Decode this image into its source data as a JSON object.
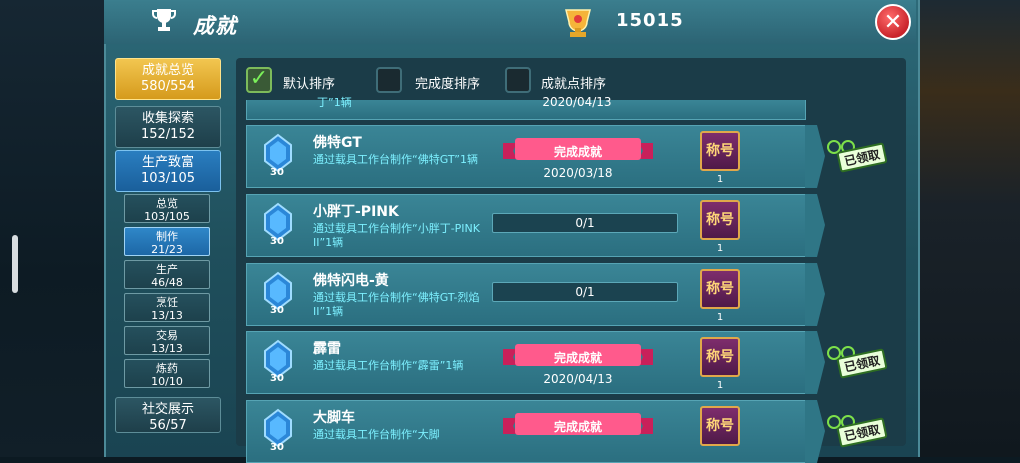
{
  "header": {
    "title": "成就",
    "points": "15015"
  },
  "sidebar": {
    "main_items": [
      {
        "label": "成就总览",
        "count": "580/554"
      },
      {
        "label": "收集探索",
        "count": "152/152"
      },
      {
        "label": "生产致富",
        "count": "103/105"
      },
      {
        "label": "社交展示",
        "count": "56/57"
      }
    ],
    "sub_items": [
      {
        "label": "总览",
        "count": "103/105"
      },
      {
        "label": "制作",
        "count": "21/23"
      },
      {
        "label": "生产",
        "count": "46/48"
      },
      {
        "label": "烹饪",
        "count": "13/13"
      },
      {
        "label": "交易",
        "count": "13/13"
      },
      {
        "label": "炼药",
        "count": "10/10"
      }
    ]
  },
  "sort": {
    "default": "默认排序",
    "completion": "完成度排序",
    "points": "成就点排序"
  },
  "partial_top": {
    "desc": "丁”1辆",
    "date": "2020/04/13"
  },
  "achievements": [
    {
      "name": "佛特GT",
      "desc": "通过载具工作台制作“佛特GT”1辆",
      "points": "30",
      "status": "完成成就",
      "date": "2020/03/18",
      "reward": "称号",
      "reward_count": "1",
      "claimed": "已领取"
    },
    {
      "name": "小胖丁-PINK",
      "desc": "通过载具工作台制作“小胖丁-PINK II”1辆",
      "points": "30",
      "progress": "0/1",
      "reward": "称号",
      "reward_count": "1"
    },
    {
      "name": "佛特闪电-黄",
      "desc": "通过载具工作台制作“佛特GT-烈焰II”1辆",
      "points": "30",
      "progress": "0/1",
      "reward": "称号",
      "reward_count": "1"
    },
    {
      "name": "霹雷",
      "desc": "通过载具工作台制作“霹雷”1辆",
      "points": "30",
      "status": "完成成就",
      "date": "2020/04/13",
      "reward": "称号",
      "reward_count": "1",
      "claimed": "已领取"
    },
    {
      "name": "大脚车",
      "desc": "通过载具工作台制作“大脚",
      "points": "30",
      "status": "完成成就",
      "reward": "称号",
      "claimed": "已领取"
    }
  ]
}
